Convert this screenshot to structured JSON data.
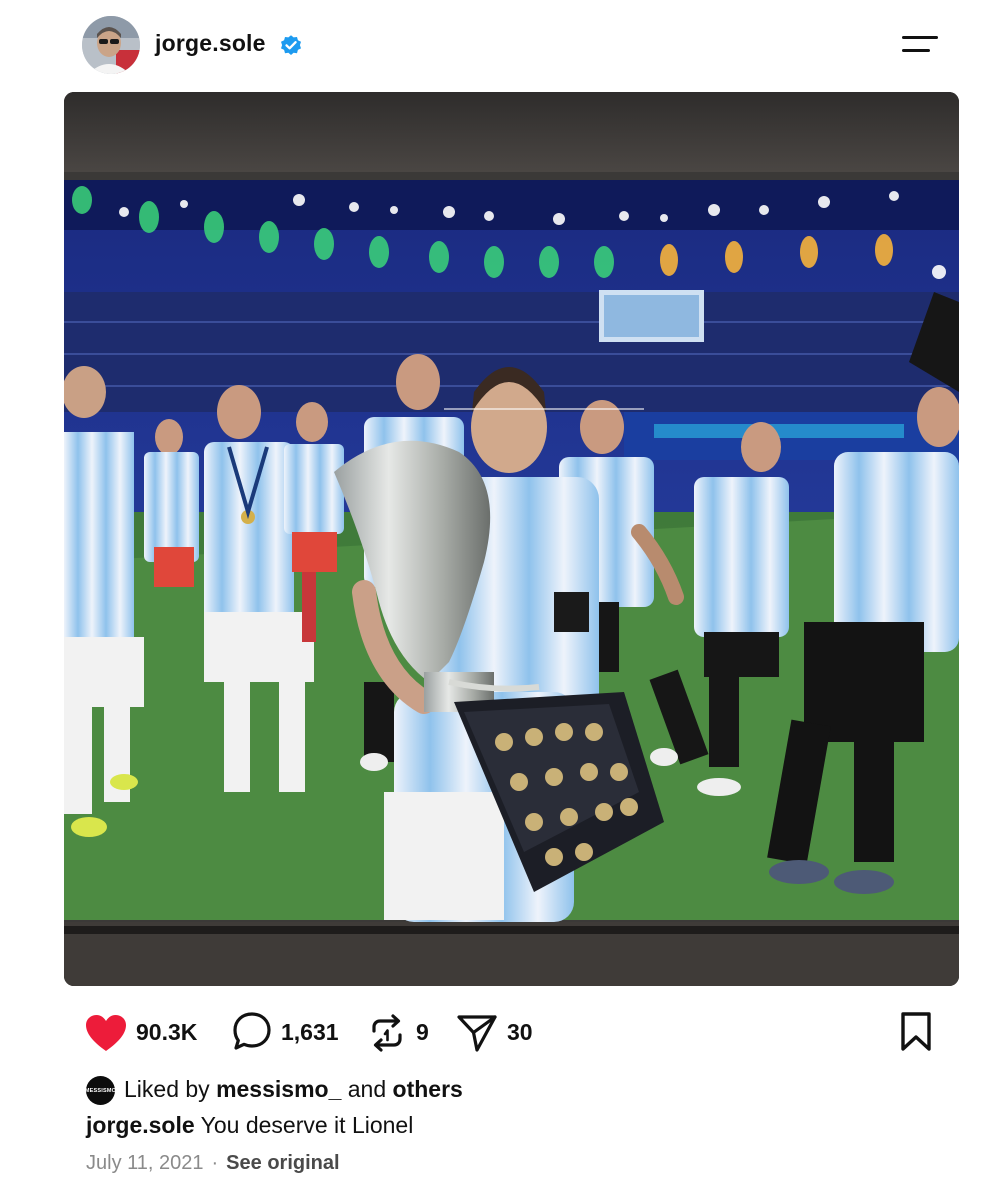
{
  "header": {
    "username": "jorge.sole",
    "verified": true,
    "menu_icon": "hamburger-menu-icon"
  },
  "media": {
    "alt_icon": "photo"
  },
  "actions": {
    "likes": "90.3K",
    "comments": "1,631",
    "reposts": "9",
    "shares": "30",
    "like_color": "#ed1c3a"
  },
  "liked_by": {
    "avatar_text": "MESSISMO",
    "prefix": "Liked by ",
    "user": "messismo_",
    "middle": " and ",
    "others": "others"
  },
  "caption": {
    "user": "jorge.sole",
    "text": " You deserve it Lionel"
  },
  "meta": {
    "date": "July 11, 2021",
    "separator": "·",
    "see_original": "See original"
  }
}
